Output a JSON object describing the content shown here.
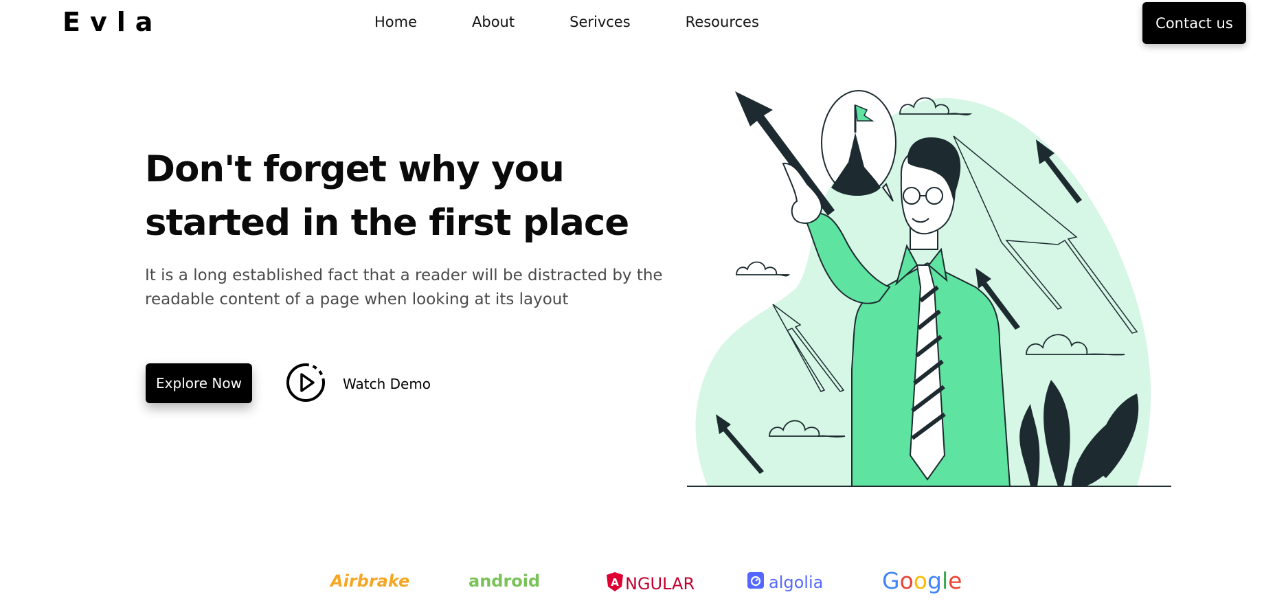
{
  "header": {
    "logo": "Evla",
    "nav": [
      "Home",
      "About",
      "Serivces",
      "Resources"
    ],
    "contact_label": "Contact us"
  },
  "hero": {
    "title": "Don't forget why you started in the first place",
    "description": "It is a long established fact that a reader will be distracted by the readable content of a page when looking at its layout",
    "explore_label": "Explore Now",
    "watch_label": "Watch Demo"
  },
  "brands": {
    "airbrake": "Airbrake",
    "android": "android",
    "angular": "NGULAR",
    "angular_mark": "A",
    "algolia": "algolia",
    "google": [
      "G",
      "o",
      "o",
      "g",
      "l",
      "e"
    ]
  },
  "colors": {
    "accent_green": "#5ee3a0",
    "blob_green": "#d6f7e6",
    "dark": "#1d2b30",
    "google_blue": "#4285f4",
    "google_red": "#ea4335",
    "google_yellow": "#fbbc05",
    "google_green": "#34a853"
  },
  "icons": {
    "play": "play-circle-icon",
    "algolia": "algolia-logo-icon",
    "angular": "angular-shield-icon"
  }
}
